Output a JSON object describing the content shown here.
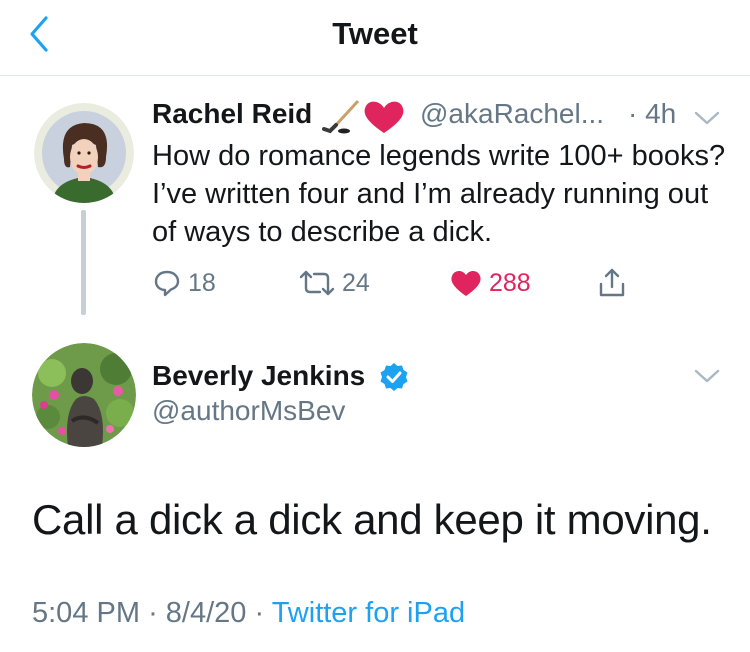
{
  "header": {
    "title": "Tweet"
  },
  "colors": {
    "accent": "#1da1f2",
    "muted": "#657786",
    "like": "#e0245e",
    "text": "#14171a",
    "divider": "#e1e8ed"
  },
  "parent_tweet": {
    "name": "Rachel Reid",
    "emojis": [
      "hockey-stick-emoji",
      "red-heart-emoji"
    ],
    "handle": "@akaRachel...",
    "time": "· 4h",
    "text": "How do romance legends write 100+ books? I’ve written four and I’m already running out of ways to describe a dick.",
    "replies": "18",
    "retweets": "24",
    "likes": "288",
    "liked": true
  },
  "main_tweet": {
    "name": "Beverly Jenkins",
    "verified": true,
    "handle": "@authorMsBev",
    "text": "Call a dick a dick and keep it moving.",
    "time": "5:04 PM",
    "date": "8/4/20",
    "source": "Twitter for iPad"
  }
}
